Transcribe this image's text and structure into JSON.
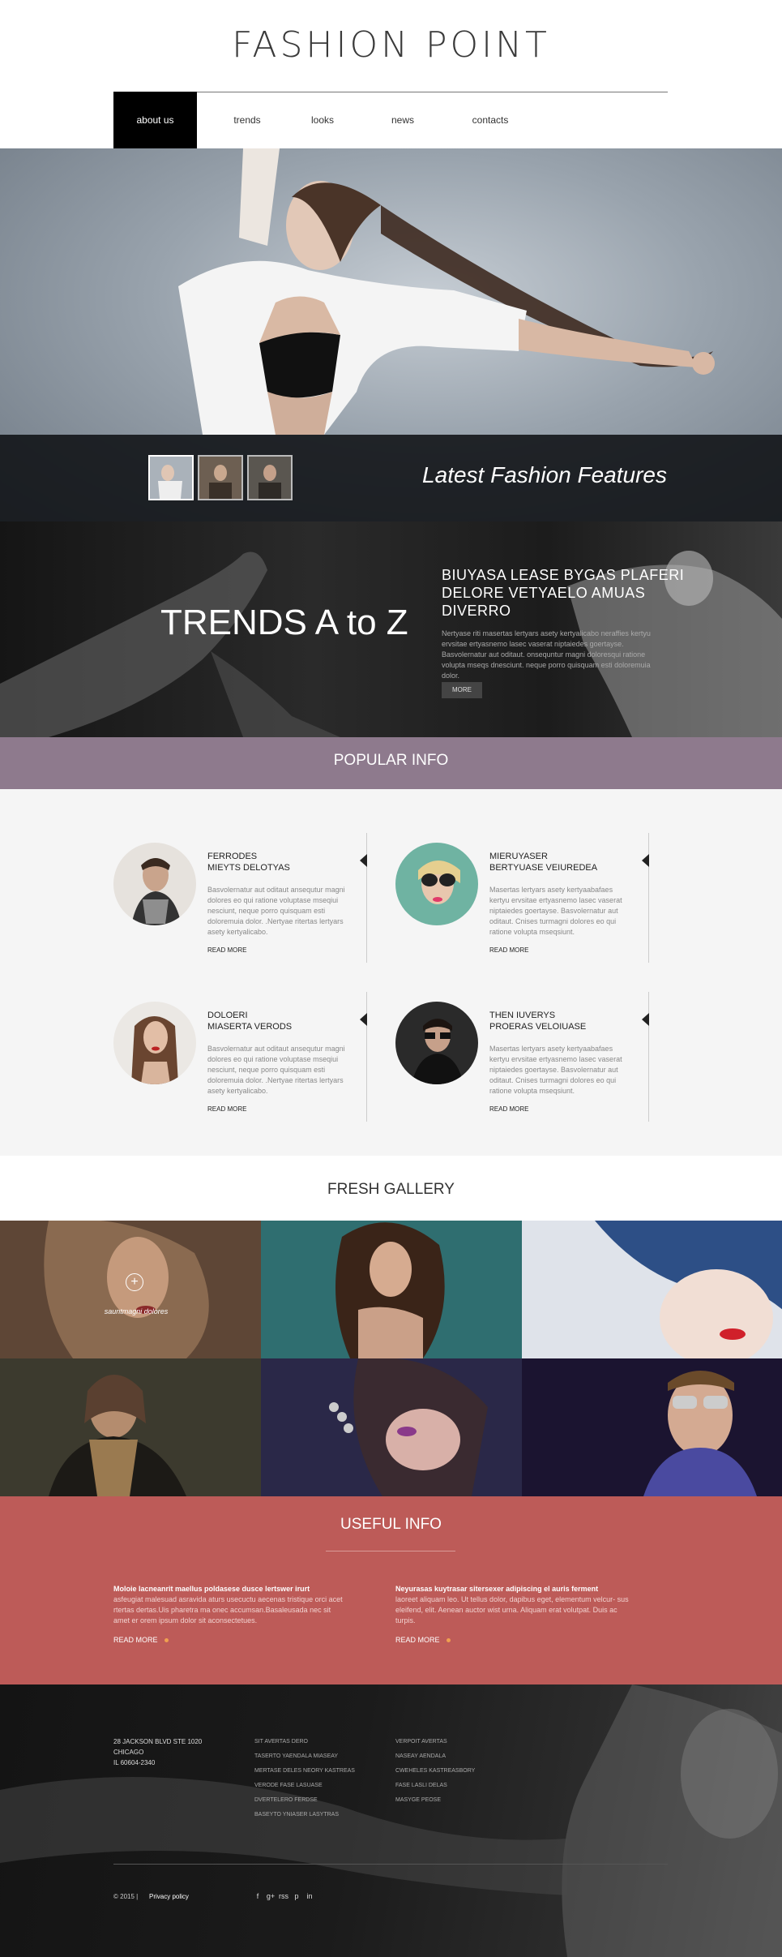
{
  "header": {
    "logo": "FASHION POINT",
    "nav": [
      {
        "label": "about us"
      },
      {
        "label": "trends"
      },
      {
        "label": "looks"
      },
      {
        "label": "news"
      },
      {
        "label": "contacts"
      }
    ]
  },
  "hero": {
    "caption": "Latest Fashion Features"
  },
  "trends": {
    "title": "TRENDS A to Z",
    "heading": "BIUYASA LEASE BYGAS PLAFERI DELORE VETYAELO AMUAS DIVERRO",
    "text": "Nertyase riti masertas lertyars asety kertyalicabo neraffies kertyu ervsitae ertyasnemo lasec vaserat niptaiedes goertayse. Basvolernatur aut oditaut. onsequntur magni doloresqui ratione volupta mseqs dnesciunt. neque porro quisquam esti doloremuia dolor.",
    "button": "MORE"
  },
  "popular": {
    "title": "POPULAR INFO",
    "cards": [
      {
        "title": "FERRODES\nMIEYTS DELOTYAS",
        "text": "Basvolernatur aut oditaut ansequtur magni dolores eo qui ratione voluptase mseqiui nesciunt, neque porro quisquam esti doloremuia dolor. .Nertyae ritertas lertyars asety kertyalicabo.",
        "more": "READ MORE"
      },
      {
        "title": "MIERUYASER\nBERTYUASE VEIUREDEA",
        "text": "Masertas lertyars asety kertyaabafaes kertyu ervsitae ertyasnemo lasec vaserat niptaiedes goertayse. Basvolernatur aut oditaut. Cnises turmagni dolores eo qui ratione volupta mseqsiunt.",
        "more": "READ MORE"
      },
      {
        "title": "DOLOERI\nMIASERTA VERODS",
        "text": "Basvolernatur aut oditaut ansequtur magni dolores eo qui ratione voluptase mseqiui nesciunt, neque porro quisquam esti doloremuia dolor. .Nertyae ritertas lertyars asety kertyalicabo.",
        "more": "READ MORE"
      },
      {
        "title": "THEN IUVERYS\nPROERAS VELOIUASE",
        "text": "Masertas lertyars asety kertyaabafaes kertyu ervsitae ertyasnemo lasec vaserat niptaiedes goertayse. Basvolernatur aut oditaut. Cnises turmagni dolores eo qui ratione volupta mseqsiunt.",
        "more": "READ MORE"
      }
    ]
  },
  "gallery": {
    "title": "FRESH GALLERY",
    "caption": "sauntmagni dolores",
    "plus": "+"
  },
  "useful": {
    "title": "USEFUL INFO",
    "cols": [
      {
        "heading": "Moloie lacneanrit maellus poldasese dusce lertswer irurt",
        "text": "asfeugiat malesuad asravida aturs usecuctu aecenas tristique orci acet rtertas dertas.Uis pharetra ma onec accumsan.Basaleusada nec sit amet er orem ipsum dolor sit aconsectetues.",
        "more": "READ MORE"
      },
      {
        "heading": "Neyurasas kuytrasar sitersexer adipiscing el auris ferment",
        "text": "laoreet aliquam leo. Ut tellus dolor, dapibus eget, elementum velcur- sus eleifend, elit. Aenean auctor wist urna. Aliquam erat volutpat. Duis ac turpis.",
        "more": "READ MORE"
      }
    ]
  },
  "footer": {
    "address": [
      "28 JACKSON BLVD STE 1020",
      "CHICAGO",
      "IL 60604-2340"
    ],
    "links1": [
      "SIT AVERTAS DERO",
      "TASERTO YAENDALA MIASEAY",
      "MERTASE DELES NEORY KASTREAS",
      "VERODE FASE LASUASE",
      "DVERTELERO FERDSE",
      "BASEYTO YNIASER LASYTRAS"
    ],
    "links2": [
      "VERPOIT AVERTAS",
      "NASEAY AENDALA",
      "CWEHELES KASTREASBORY",
      "FASE LASLI DELAS",
      "MASYGE PEOSE"
    ],
    "copyright": "© 2015  |",
    "privacy": "Privacy policy",
    "social": [
      "f",
      "g+",
      "rss",
      "p",
      "in"
    ]
  },
  "colors": {
    "popular_band": "#8e7a8d",
    "useful_band": "#bd5b58",
    "accent_dot": "#f0a050"
  }
}
